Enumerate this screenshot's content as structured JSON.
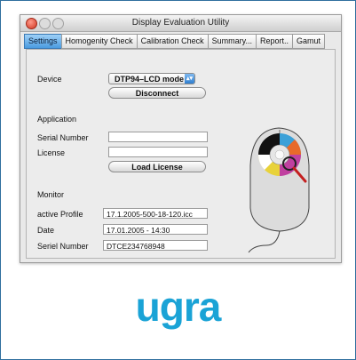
{
  "window": {
    "title": "Display Evaluation Utility"
  },
  "tabs": [
    "Settings",
    "Homogenity Check",
    "Calibration Check",
    "Summary...",
    "Report..",
    "Gamut"
  ],
  "device": {
    "label": "Device",
    "selected": "DTP94–LCD mode",
    "disconnect": "Disconnect"
  },
  "application": {
    "heading": "Application",
    "serial_label": "Serial Number",
    "serial_value": "",
    "license_label": "License",
    "license_value": "",
    "load_license": "Load License"
  },
  "monitor": {
    "heading": "Monitor",
    "profile_label": "active Profile",
    "profile_value": "17.1.2005-500-18-120.icc",
    "date_label": "Date",
    "date_value": "17.01.2005 - 14:30",
    "serial_label": "Seriel Number",
    "serial_value": "DTCE234768948"
  },
  "brand": {
    "logo_text": "ugra",
    "color": "#1aa3d6"
  }
}
